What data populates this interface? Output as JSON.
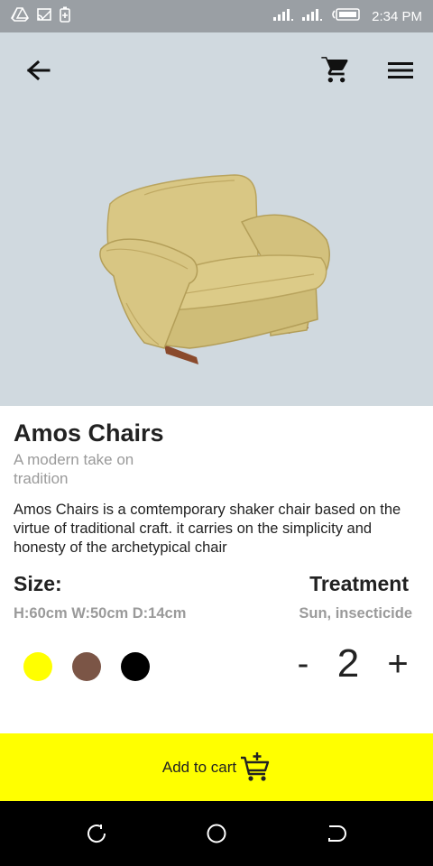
{
  "status_bar": {
    "time": "2:34 PM",
    "left_icons": [
      "drive-icon",
      "cast-icon",
      "battery-saver-icon"
    ],
    "right_icons": [
      "signal-icon",
      "signal-icon",
      "battery-icon"
    ]
  },
  "toolbar": {
    "back_icon": "back-arrow-icon",
    "cart_icon": "cart-icon",
    "menu_icon": "menu-icon"
  },
  "product": {
    "title": "Amos Chairs",
    "subtitle": "A modern take on tradition",
    "description": "Amos Chairs is a comtemporary shaker chair based on the virtue of traditional craft. it carries on the simplicity and honesty of the archetypical chair",
    "size_label": "Size:",
    "size_value": "H:60cm W:50cm D:14cm",
    "treatment_label": "Treatment",
    "treatment_value": "Sun, insecticide",
    "colors": [
      "#ffff00",
      "#7b5546",
      "#000000"
    ],
    "quantity": "2",
    "minus_label": "-",
    "plus_label": "+"
  },
  "add_to_cart": {
    "label": "Add to cart",
    "icon": "add-to-cart-icon",
    "background": "#ffff00"
  },
  "colors": {
    "status_bar": "#9a9fa4",
    "hero_background": "#d0d9df",
    "muted_text": "#9a9a9a",
    "nav_bar": "#000000"
  }
}
